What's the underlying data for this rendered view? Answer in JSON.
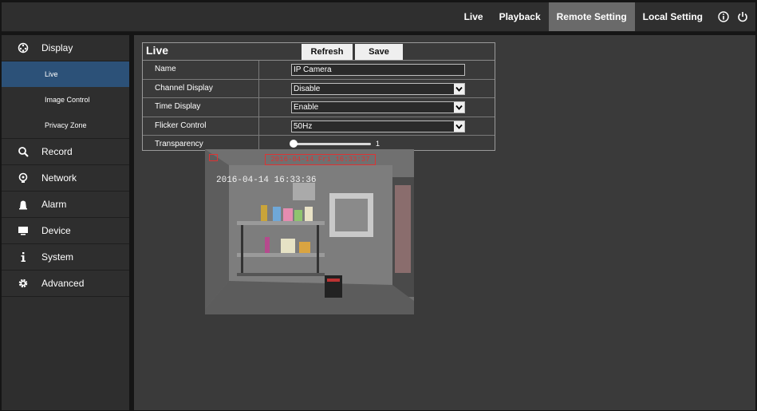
{
  "topnav": {
    "items": [
      "Live",
      "Playback",
      "Remote Setting",
      "Local Setting"
    ],
    "active": "Remote Setting",
    "icons": [
      "info-icon",
      "power-icon"
    ]
  },
  "sidebar": {
    "items": [
      {
        "label": "Display",
        "icon": "display-icon"
      },
      {
        "label": "Record",
        "icon": "search-icon"
      },
      {
        "label": "Network",
        "icon": "network-icon"
      },
      {
        "label": "Alarm",
        "icon": "alarm-icon"
      },
      {
        "label": "Device",
        "icon": "device-icon"
      },
      {
        "label": "System",
        "icon": "info-icon"
      },
      {
        "label": "Advanced",
        "icon": "gear-icon"
      }
    ],
    "display_sub": [
      "Live",
      "Image Control",
      "Privacy Zone"
    ],
    "active_sub": "Live"
  },
  "panel": {
    "title": "Live",
    "refresh_label": "Refresh",
    "save_label": "Save",
    "rows": [
      {
        "label": "Name",
        "value": "IP Camera"
      },
      {
        "label": "Channel Display",
        "value": "Disable"
      },
      {
        "label": "Time Display",
        "value": "Enable"
      },
      {
        "label": "Flicker Control",
        "value": "50Hz"
      },
      {
        "label": "Transparency",
        "value": "1"
      }
    ]
  },
  "preview": {
    "osd_red": "2016-04-14 Fri 16:33:37",
    "osd_time": "2016-04-14 16:33:36"
  },
  "colors": {
    "active_nav_bg": "#6a6a6a",
    "active_sub_bg": "#2c5178",
    "osd_red": "#dd3333"
  }
}
